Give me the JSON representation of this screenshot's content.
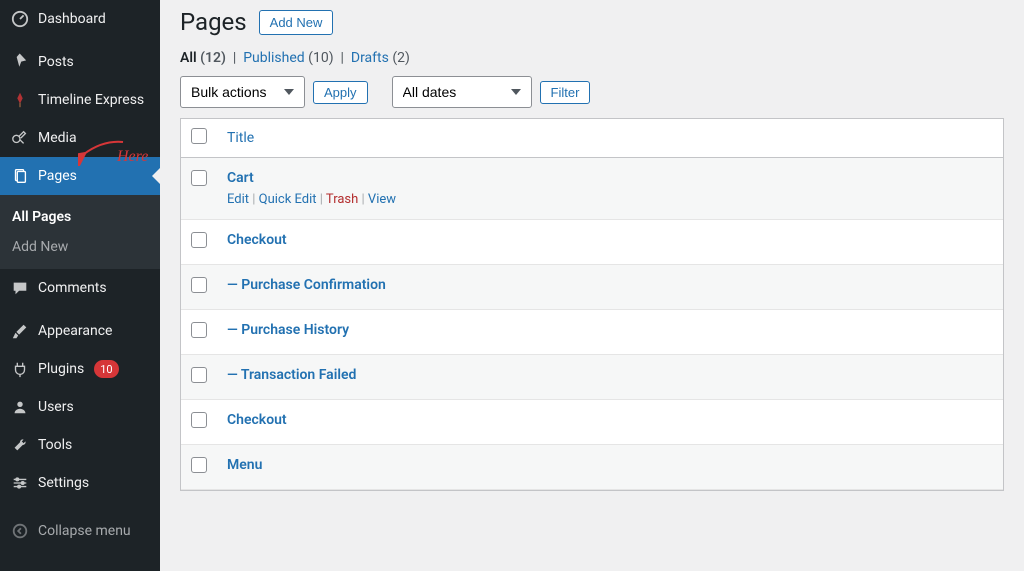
{
  "sidebar": {
    "items": [
      {
        "id": "dashboard",
        "label": "Dashboard",
        "icon": "dashboard-icon"
      },
      {
        "id": "posts",
        "label": "Posts",
        "icon": "pin-icon"
      },
      {
        "id": "timeline",
        "label": "Timeline Express",
        "icon": "timeline-icon"
      },
      {
        "id": "media",
        "label": "Media",
        "icon": "media-icon"
      },
      {
        "id": "pages",
        "label": "Pages",
        "icon": "pages-icon",
        "active": true
      },
      {
        "id": "comments",
        "label": "Comments",
        "icon": "comment-icon"
      },
      {
        "id": "appearance",
        "label": "Appearance",
        "icon": "brush-icon"
      },
      {
        "id": "plugins",
        "label": "Plugins",
        "icon": "plug-icon",
        "badge": "10"
      },
      {
        "id": "users",
        "label": "Users",
        "icon": "user-icon"
      },
      {
        "id": "tools",
        "label": "Tools",
        "icon": "wrench-icon"
      },
      {
        "id": "settings",
        "label": "Settings",
        "icon": "sliders-icon"
      }
    ],
    "submenu": [
      {
        "label": "All Pages",
        "current": true
      },
      {
        "label": "Add New"
      }
    ],
    "collapse_label": "Collapse menu"
  },
  "annotation": {
    "text": "Here"
  },
  "header": {
    "title": "Pages",
    "add_new": "Add New"
  },
  "filters": {
    "sub": [
      {
        "label": "All",
        "count": "(12)",
        "current": true
      },
      {
        "label": "Published",
        "count": "(10)"
      },
      {
        "label": "Drafts",
        "count": "(2)"
      }
    ],
    "bulk_selected": "Bulk actions",
    "apply": "Apply",
    "date_selected": "All dates",
    "filter": "Filter"
  },
  "table": {
    "col_title": "Title",
    "rows": [
      {
        "title": "Cart",
        "show_actions": true,
        "child": false
      },
      {
        "title": "Checkout",
        "child": false
      },
      {
        "title": "Purchase Confirmation",
        "child": true
      },
      {
        "title": "Purchase History",
        "child": true
      },
      {
        "title": "Transaction Failed",
        "child": true
      },
      {
        "title": "Checkout",
        "child": false
      },
      {
        "title": "Menu",
        "child": false
      }
    ],
    "child_prefix": "— ",
    "actions": {
      "edit": "Edit",
      "quick": "Quick Edit",
      "trash": "Trash",
      "view": "View",
      "sep": " | "
    }
  }
}
